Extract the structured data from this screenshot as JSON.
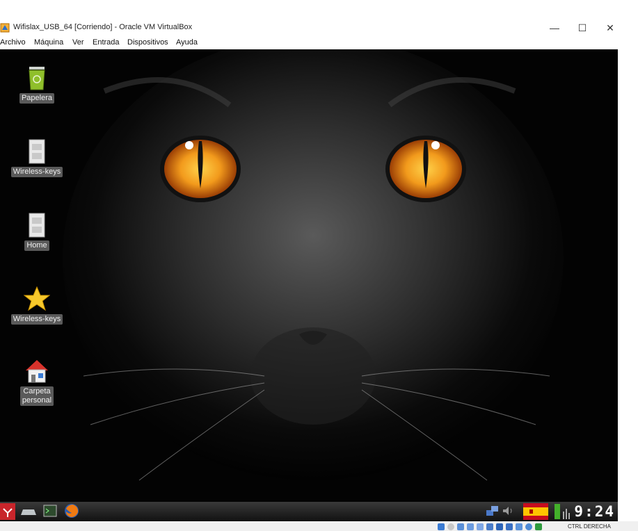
{
  "window": {
    "title": "Wifislax_USB_64 [Corriendo] - Oracle VM VirtualBox",
    "minimize": "—",
    "maximize": "☐",
    "close": "✕"
  },
  "menu": [
    "Archivo",
    "Máquina",
    "Ver",
    "Entrada",
    "Dispositivos",
    "Ayuda"
  ],
  "desktop_icons": [
    {
      "label": "Papelera",
      "icon": "trash-icon"
    },
    {
      "label": "Wireless-keys",
      "icon": "document-icon"
    },
    {
      "label": "Home",
      "icon": "document-icon"
    },
    {
      "label": "Wireless-keys",
      "icon": "star-icon"
    },
    {
      "label_line1": "Carpeta",
      "label_line2": "personal",
      "icon": "home-folder-icon"
    }
  ],
  "taskbar": {
    "clock": "9:24",
    "items": [
      "start-menu-icon",
      "drive-icon",
      "terminal-icon",
      "firefox-icon"
    ],
    "tray": [
      "network-icon",
      "volume-icon",
      "spain-flag-icon",
      "battery-icon"
    ]
  },
  "host_status": {
    "host_key": "CTRL DERECHA"
  },
  "colors": {
    "accent_eye": "#f29a1c",
    "taskbar": "#1a1a1a",
    "start": "#c8252b"
  }
}
